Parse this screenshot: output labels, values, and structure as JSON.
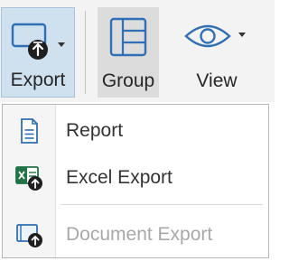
{
  "ribbon": {
    "export": {
      "label": "Export",
      "icon": "export-icon"
    },
    "group": {
      "label": "Group",
      "icon": "group-icon"
    },
    "view": {
      "label": "View",
      "icon": "eye-icon"
    }
  },
  "menu": {
    "items": [
      {
        "label": "Report",
        "icon": "report-document-icon",
        "enabled": true
      },
      {
        "label": "Excel Export",
        "icon": "excel-export-icon",
        "enabled": true
      },
      {
        "label": "Document Export",
        "icon": "document-export-icon",
        "enabled": false
      }
    ]
  },
  "colors": {
    "accent_blue": "#2f6fb5",
    "export_active_bg": "#cfe0ef",
    "group_active_bg": "#dcdcdc",
    "excel_green": "#217346",
    "disabled_text": "#a8a8a8"
  }
}
